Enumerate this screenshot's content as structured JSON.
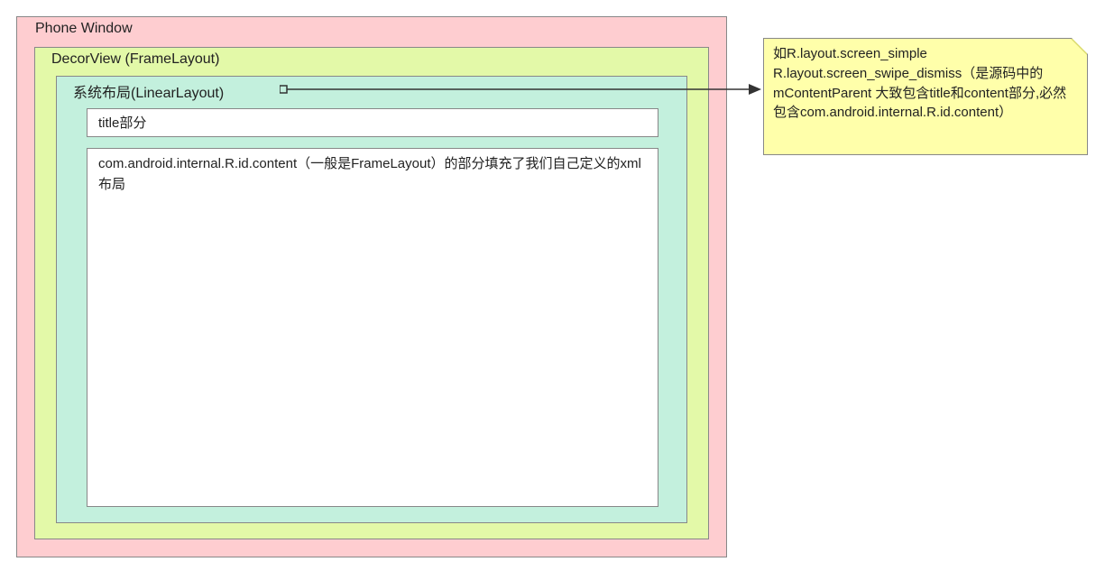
{
  "phoneWindow": {
    "label": "Phone Window"
  },
  "decorView": {
    "label": "DecorView (FrameLayout)"
  },
  "systemLayout": {
    "label": "系统布局(LinearLayout)"
  },
  "titleBox": {
    "text": "title部分"
  },
  "contentBox": {
    "text": "com.android.internal.R.id.content（一般是FrameLayout）的部分填充了我们自己定义的xml布局"
  },
  "note": {
    "text": "如R.layout.screen_simple R.layout.screen_swipe_dismiss（是源码中的mContentParent 大致包含title和content部分,必然包含com.android.internal.R.id.content）"
  }
}
